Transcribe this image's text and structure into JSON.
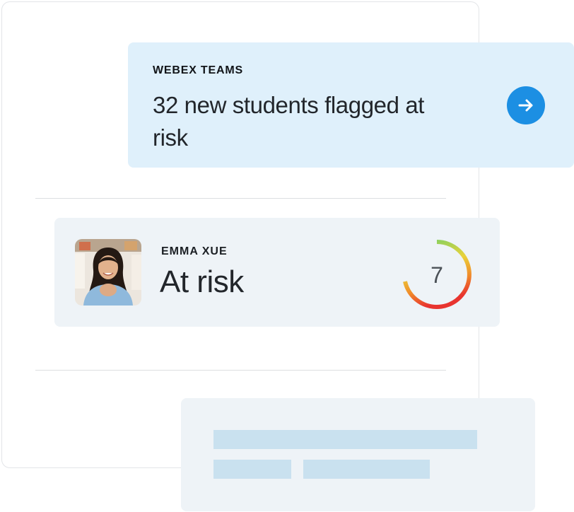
{
  "notification": {
    "source": "WEBEX TEAMS",
    "message": "32 new students flagged at risk",
    "action_icon": "arrow-right-icon",
    "accent_color": "#1c8fe3",
    "background_color": "#dff0fb"
  },
  "student": {
    "name": "EMMA XUE",
    "status": "At risk",
    "avatar_icon": "student-photo",
    "risk_score": "7",
    "gauge_colors": [
      "#6fd06a",
      "#e9d23a",
      "#f08a2a",
      "#e8342f"
    ]
  },
  "placeholder": {
    "bar_color": "#c9e1ef",
    "background_color": "#eef3f7"
  }
}
